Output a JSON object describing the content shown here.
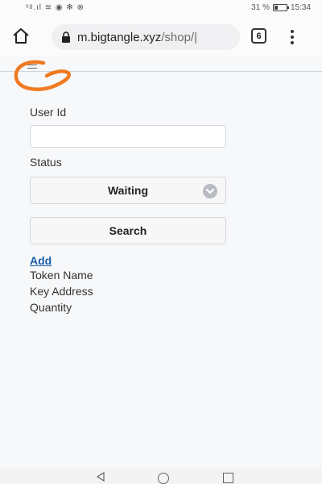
{
  "status_bar": {
    "left_icons": "ˢᵍ.ıl ≋ ◉ ✻ ⊗",
    "battery_percent": "31 %",
    "time": "15:34"
  },
  "browser": {
    "url_host": "m.bigtangle.xyz",
    "url_path": "/shop/|",
    "tab_count": "6",
    "icons": [
      "home-icon",
      "lock-icon",
      "tabs-icon",
      "menu-kebab-icon"
    ]
  },
  "form": {
    "user_id_label": "User Id",
    "user_id_value": "",
    "status_label": "Status",
    "status_selected": "Waiting",
    "search_label": "Search",
    "add_label": "Add"
  },
  "details": {
    "token_name_label": "Token Name",
    "key_address_label": "Key Address",
    "quantity_label": "Quantity"
  },
  "colors": {
    "link": "#1a5ea8",
    "annotation": "#f07a22"
  }
}
